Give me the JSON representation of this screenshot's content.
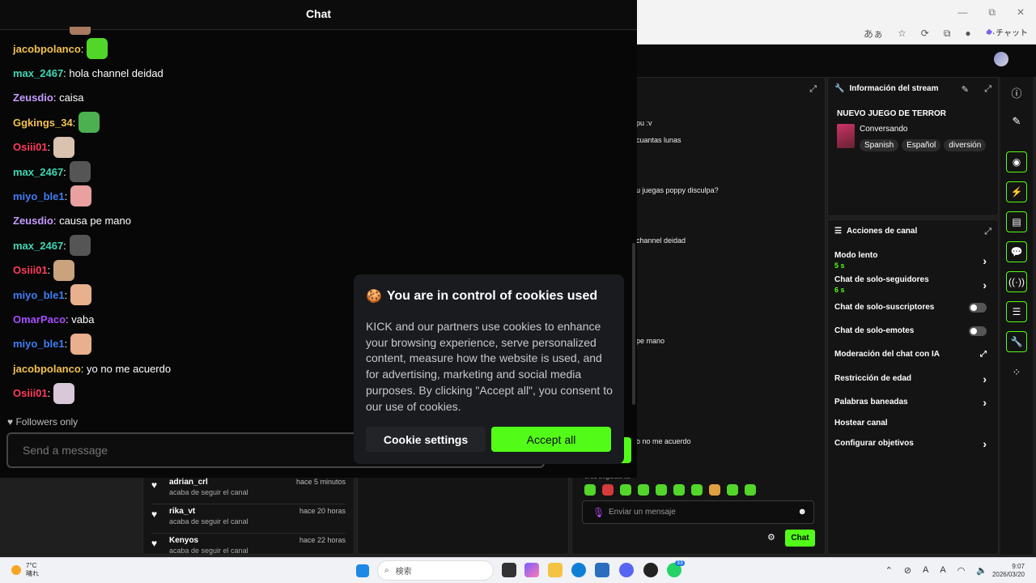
{
  "browser": {
    "window_buttons": [
      "—",
      "⧉",
      "✕"
    ],
    "translate_label": "あぁ",
    "copilot_label": "チャット"
  },
  "popout_chat": {
    "title": "Chat",
    "messages": [
      {
        "user": "jacobpolanco",
        "color": "#f2c14e",
        "sep": ":",
        "text": "",
        "emote": "#53d62a"
      },
      {
        "user": "max_2467",
        "color": "#3fd6b4",
        "sep": ":",
        "text": " hola channel deidad",
        "emote": ""
      },
      {
        "user": "Zeusdio",
        "color": "#c59bff",
        "sep": ":",
        "text": " caisa",
        "emote": ""
      },
      {
        "user": "Ggkings_34",
        "color": "#f2c14e",
        "sep": ":",
        "text": "",
        "emote": "#4caf50"
      },
      {
        "user": "Osiii01",
        "color": "#ff3b5c",
        "sep": ":",
        "text": "",
        "emote": "#d9c2b0"
      },
      {
        "user": "max_2467",
        "color": "#3fd6b4",
        "sep": ":",
        "text": "",
        "emote": "#555555"
      },
      {
        "user": "miyo_ble1",
        "color": "#3f7df2",
        "sep": ":",
        "text": "",
        "emote": "#e8a0a0"
      },
      {
        "user": "Zeusdio",
        "color": "#c59bff",
        "sep": ":",
        "text": " causa pe mano",
        "emote": ""
      },
      {
        "user": "max_2467",
        "color": "#3fd6b4",
        "sep": ":",
        "text": "",
        "emote": "#555555"
      },
      {
        "user": "Osiii01",
        "color": "#ff3b5c",
        "sep": ":",
        "text": "",
        "emote": "#c9a27e"
      },
      {
        "user": "miyo_ble1",
        "color": "#3f7df2",
        "sep": ":",
        "text": "",
        "emote": "#e8b08c"
      },
      {
        "user": "OmarPaco",
        "color": "#a64dff",
        "sep": ":",
        "text": " vaba",
        "emote": ""
      },
      {
        "user": "miyo_ble1",
        "color": "#3f7df2",
        "sep": ":",
        "text": "",
        "emote": "#e8b08c"
      },
      {
        "user": "jacobpolanco",
        "color": "#f2c14e",
        "sep": ":",
        "text": " yo no me acuerdo",
        "emote": ""
      },
      {
        "user": "Osiii01",
        "color": "#ff3b5c",
        "sep": ":",
        "text": "",
        "emote": "#d8c8d8"
      }
    ],
    "followers_only": "Followers only",
    "send_placeholder": "Send a message"
  },
  "cookie": {
    "title": "You are in control of cookies used",
    "body": "KICK and our partners use cookies to enhance your browsing experience, serve personalized content, measure how the website is used, and for advertising, marketing and social media purposes. By clicking \"Accept all\", you consent to our use of cookies.",
    "settings_label": "Cookie settings",
    "accept_label": "Accept all"
  },
  "dash_chat": {
    "partial_lines": [
      "pu :v",
      "cuantas lunas",
      "u juegas poppy disculpa?",
      "channel deidad",
      "pe mano",
      "o no me acuerdo"
    ],
    "partial_label": "ores seguidores",
    "input_placeholder": "Enviar un mensaje",
    "chat_button": "Chat",
    "emote_colors": [
      "#53d62a",
      "#d63a3a",
      "#53d62a",
      "#53d62a",
      "#53d62a",
      "#53d62a",
      "#53d62a",
      "#e0a040",
      "#53d62a",
      "#53d62a"
    ]
  },
  "stream_info": {
    "title": "Información del stream",
    "stream_title": "NUEVO JUEGO DE TERROR",
    "category": "Conversando",
    "tags": [
      "Spanish",
      "Español",
      "diversión"
    ]
  },
  "channel_actions": {
    "title": "Acciones de canal",
    "rows": [
      {
        "label": "Modo lento",
        "sub": "5 s",
        "control": "chevron"
      },
      {
        "label": "Chat de solo-seguidores",
        "sub": "6 s",
        "control": "chevron"
      },
      {
        "label": "Chat de solo-suscriptores",
        "sub": "",
        "control": "toggle"
      },
      {
        "label": "Chat de solo-emotes",
        "sub": "",
        "control": "toggle"
      },
      {
        "label": "Moderación del chat con IA",
        "sub": "",
        "control": "external"
      },
      {
        "label": "Restricción de edad",
        "sub": "",
        "control": "chevron"
      },
      {
        "label": "Palabras baneadas",
        "sub": "",
        "control": "chevron"
      },
      {
        "label": "Hostear canal",
        "sub": "",
        "control": "none"
      },
      {
        "label": "Configurar objetivos",
        "sub": "",
        "control": "chevron"
      }
    ]
  },
  "followers": [
    {
      "name": "adrian_crl",
      "when": "hace 5 minutos",
      "action": "acaba de seguir el canal"
    },
    {
      "name": "rika_vt",
      "when": "hace 20 horas",
      "action": "acaba de seguir el canal"
    },
    {
      "name": "Kenyos",
      "when": "hace 22 horas",
      "action": "acaba de seguir el canal"
    }
  ],
  "taskbar": {
    "weather_temp": "7°C",
    "weather_desc": "晴れ",
    "search_label": "検索",
    "time": "9:07",
    "date": "2026/03/20",
    "badge_count": "33"
  }
}
